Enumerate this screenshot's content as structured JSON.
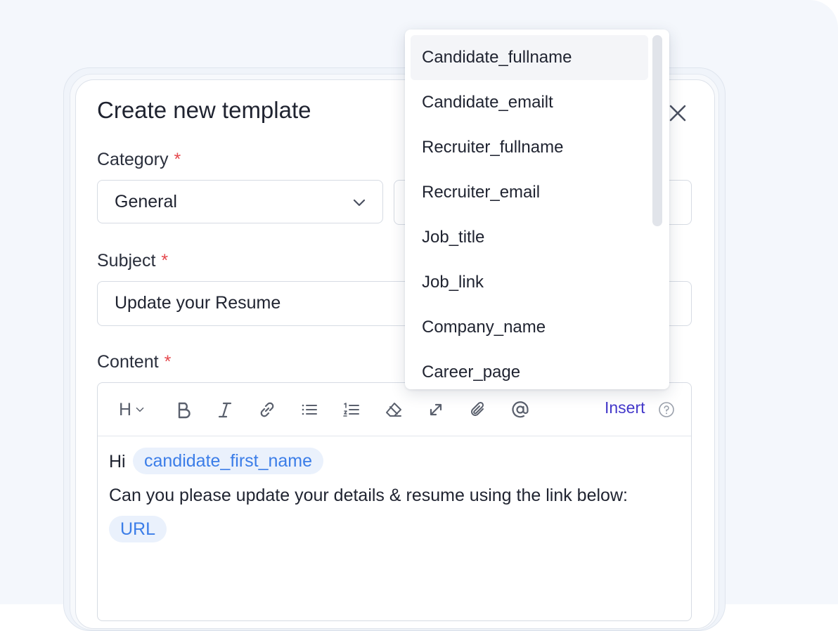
{
  "modal": {
    "title": "Create new template"
  },
  "form": {
    "category_label": "Category",
    "category_value": "General",
    "subject_label": "Subject",
    "subject_value": "Update your Resume",
    "content_label": "Content",
    "required_mark": "*"
  },
  "toolbar": {
    "heading_label": "H",
    "insert_label": "Insert"
  },
  "editor": {
    "line1_prefix": "Hi",
    "chip_candidate": "candidate_first_name",
    "line2": "Can you please update your details & resume using the link below:",
    "chip_url": "URL"
  },
  "dropdown": {
    "items": [
      "Candidate_fullname",
      "Candidate_emailt",
      "Recruiter_fullname",
      "Recruiter_email",
      "Job_title",
      "Job_link",
      "Company_name",
      "Career_page"
    ]
  },
  "colors": {
    "accent": "#4338ca",
    "chip_text": "#3b7de8",
    "chip_bg": "#eaf1fc",
    "required": "#e5484d"
  }
}
